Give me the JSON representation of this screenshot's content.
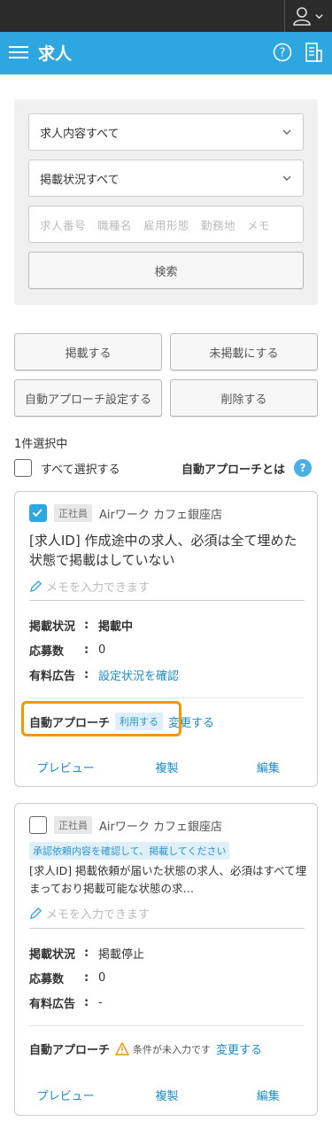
{
  "header": {
    "title": "求人"
  },
  "filter": {
    "content_select": "求人内容すべて",
    "status_select": "掲載状況すべて",
    "keyword_placeholder": "求人番号　職種名　雇用形態　勤務地　メモ",
    "search_label": "検索"
  },
  "bulk_actions": {
    "publish": "掲載する",
    "unpublish": "未掲載にする",
    "auto_approach_settings": "自動アプローチ設定する",
    "delete": "削除する"
  },
  "selection": {
    "count_text": "1件選択中",
    "select_all": "すべて選択する",
    "auto_approach_about": "自動アプローチとは",
    "help_glyph": "?"
  },
  "jobs": [
    {
      "checked": true,
      "employment_tag": "正社員",
      "store": "Airワーク カフェ銀座店",
      "title": "[求人ID] 作成途中の求人、必須は全て埋めた状態で掲載はしていない",
      "memo_placeholder": "メモを入力できます",
      "status_label": "掲載状況",
      "status_value": "掲載中",
      "applicants_label": "応募数",
      "applicants_value": "0",
      "ads_label": "有料広告",
      "ads_value": "設定状況を確認",
      "auto_label": "自動アプローチ",
      "auto_badge": "利用する",
      "auto_change": "変更する",
      "preview": "プレビュー",
      "duplicate": "複製",
      "edit": "編集"
    },
    {
      "checked": false,
      "employment_tag": "正社員",
      "store": "Airワーク カフェ銀座店",
      "notice": "承認依頼内容を確認して、掲載してください",
      "title": "[求人ID] 掲載依頼が届いた状態の求人、必須はすべて埋まっており掲載可能な状態の求…",
      "memo_placeholder": "メモを入力できます",
      "status_label": "掲載状況",
      "status_value": "掲載停止",
      "applicants_label": "応募数",
      "applicants_value": "0",
      "ads_label": "有料広告",
      "ads_value": "-",
      "auto_label": "自動アプローチ",
      "auto_warning": "条件が未入力です",
      "auto_change": "変更する",
      "preview": "プレビュー",
      "duplicate": "複製",
      "edit": "編集"
    }
  ],
  "colors": {
    "brand": "#2ea7e0",
    "highlight": "#f39800",
    "link": "#1a8ccf"
  }
}
